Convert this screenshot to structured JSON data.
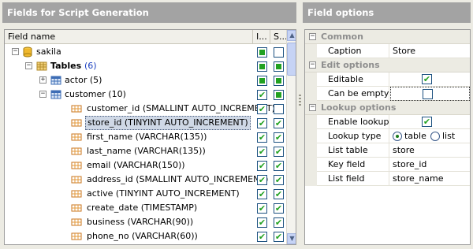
{
  "left_panel": {
    "title": "Fields for Script Generation",
    "columns": {
      "name": "Field name",
      "col2": "I...",
      "col3": "S..."
    },
    "tree": {
      "db": "sakila",
      "tables_label": "Tables",
      "tables_count": "(6)",
      "actor": "actor (5)",
      "customer": "customer (10)",
      "fields": [
        "customer_id (SMALLINT AUTO_INCREMENT)",
        "store_id (TINYINT AUTO_INCREMENT)",
        "first_name (VARCHAR(135))",
        "last_name (VARCHAR(135))",
        "email (VARCHAR(150))",
        "address_id (SMALLINT AUTO_INCREMENT)",
        "active (TINYINT AUTO_INCREMENT)",
        "create_date (TIMESTAMP)",
        "business (VARCHAR(90))",
        "phone_no (VARCHAR(60))"
      ]
    }
  },
  "right_panel": {
    "title": "Field options",
    "categories": {
      "common": "Common",
      "edit": "Edit options",
      "lookup": "Lookup options"
    },
    "props": {
      "caption_label": "Caption",
      "caption_value": "Store",
      "editable_label": "Editable",
      "can_be_empty_label": "Can be empty",
      "enable_lookup_label": "Enable lookup",
      "lookup_type_label": "Lookup type",
      "lookup_type_table": "table",
      "lookup_type_list": "list",
      "list_table_label": "List table",
      "list_table_value": "store",
      "key_field_label": "Key field",
      "key_field_value": "store_id",
      "list_field_label": "List field",
      "list_field_value": "store_name"
    }
  },
  "colors": {
    "header_bg": "#a3a3a3",
    "check_green": "#21a121",
    "selection_bg": "#cfd8e6"
  },
  "icons": {
    "database": "database-icon",
    "tables": "tables-folder-icon",
    "table": "table-icon",
    "field": "field-icon"
  }
}
